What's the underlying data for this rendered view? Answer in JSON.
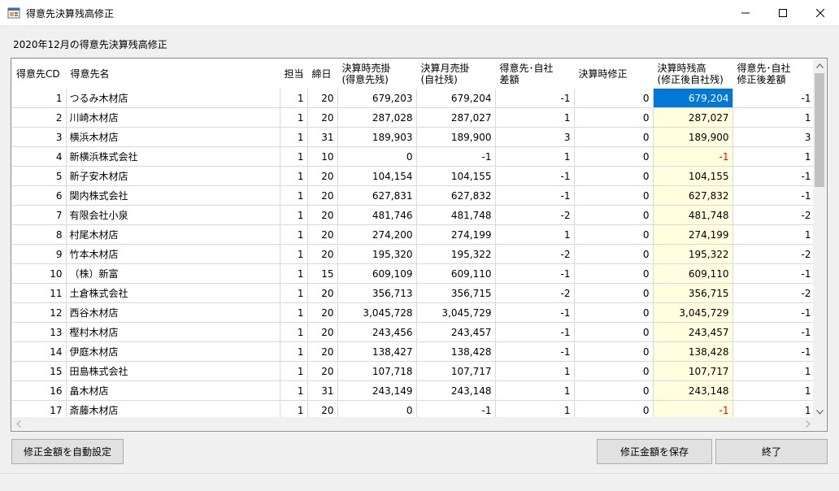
{
  "window": {
    "title": "得意先決算残高修正"
  },
  "subtitle": "2020年12月の得意先決算残高修正",
  "columns": [
    {
      "key": "cd",
      "l1": "得意先CD",
      "l2": ""
    },
    {
      "key": "name",
      "l1": "得意先名",
      "l2": ""
    },
    {
      "key": "staff",
      "l1": "担当",
      "l2": ""
    },
    {
      "key": "close",
      "l1": "締日",
      "l2": ""
    },
    {
      "key": "ar",
      "l1": "決算時売掛",
      "l2": "(得意先残)"
    },
    {
      "key": "ar_self",
      "l1": "決算月売掛",
      "l2": "(自社残)"
    },
    {
      "key": "diff",
      "l1": "得意先･自社",
      "l2": "差額"
    },
    {
      "key": "adj",
      "l1": "決算時修正",
      "l2": ""
    },
    {
      "key": "bal",
      "l1": "決算時残高",
      "l2": "(修正後自社残)"
    },
    {
      "key": "diff2",
      "l1": "得意先･自社",
      "l2": "修正後差額"
    }
  ],
  "rows": [
    {
      "cd": "1",
      "name": "つるみ木材店",
      "staff": "1",
      "close": "20",
      "ar": "679,203",
      "ar_self": "679,204",
      "diff": "-1",
      "adj": "0",
      "bal": "679,204",
      "diff2": "-1"
    },
    {
      "cd": "2",
      "name": "川崎木材店",
      "staff": "1",
      "close": "20",
      "ar": "287,028",
      "ar_self": "287,027",
      "diff": "1",
      "adj": "0",
      "bal": "287,027",
      "diff2": "1"
    },
    {
      "cd": "3",
      "name": "横浜木材店",
      "staff": "1",
      "close": "31",
      "ar": "189,903",
      "ar_self": "189,900",
      "diff": "3",
      "adj": "0",
      "bal": "189,900",
      "diff2": "3"
    },
    {
      "cd": "4",
      "name": "新横浜株式会社",
      "staff": "1",
      "close": "10",
      "ar": "0",
      "ar_self": "-1",
      "diff": "1",
      "adj": "0",
      "bal": "-1",
      "diff2": "1"
    },
    {
      "cd": "5",
      "name": "新子安木材店",
      "staff": "1",
      "close": "20",
      "ar": "104,154",
      "ar_self": "104,155",
      "diff": "-1",
      "adj": "0",
      "bal": "104,155",
      "diff2": "-1"
    },
    {
      "cd": "6",
      "name": "関内株式会社",
      "staff": "1",
      "close": "20",
      "ar": "627,831",
      "ar_self": "627,832",
      "diff": "-1",
      "adj": "0",
      "bal": "627,832",
      "diff2": "-1"
    },
    {
      "cd": "7",
      "name": "有限会社小泉",
      "staff": "1",
      "close": "20",
      "ar": "481,746",
      "ar_self": "481,748",
      "diff": "-2",
      "adj": "0",
      "bal": "481,748",
      "diff2": "-2"
    },
    {
      "cd": "8",
      "name": "村尾木材店",
      "staff": "1",
      "close": "20",
      "ar": "274,200",
      "ar_self": "274,199",
      "diff": "1",
      "adj": "0",
      "bal": "274,199",
      "diff2": "1"
    },
    {
      "cd": "9",
      "name": "竹本木材店",
      "staff": "1",
      "close": "20",
      "ar": "195,320",
      "ar_self": "195,322",
      "diff": "-2",
      "adj": "0",
      "bal": "195,322",
      "diff2": "-2"
    },
    {
      "cd": "10",
      "name": "（株）新富",
      "staff": "1",
      "close": "15",
      "ar": "609,109",
      "ar_self": "609,110",
      "diff": "-1",
      "adj": "0",
      "bal": "609,110",
      "diff2": "-1"
    },
    {
      "cd": "11",
      "name": "土倉株式会社",
      "staff": "1",
      "close": "20",
      "ar": "356,713",
      "ar_self": "356,715",
      "diff": "-2",
      "adj": "0",
      "bal": "356,715",
      "diff2": "-2"
    },
    {
      "cd": "12",
      "name": "西谷木材店",
      "staff": "1",
      "close": "20",
      "ar": "3,045,728",
      "ar_self": "3,045,729",
      "diff": "-1",
      "adj": "0",
      "bal": "3,045,729",
      "diff2": "-1"
    },
    {
      "cd": "13",
      "name": "樫村木材店",
      "staff": "1",
      "close": "20",
      "ar": "243,456",
      "ar_self": "243,457",
      "diff": "-1",
      "adj": "0",
      "bal": "243,457",
      "diff2": "-1"
    },
    {
      "cd": "14",
      "name": "伊庭木材店",
      "staff": "1",
      "close": "20",
      "ar": "138,427",
      "ar_self": "138,428",
      "diff": "-1",
      "adj": "0",
      "bal": "138,428",
      "diff2": "-1"
    },
    {
      "cd": "15",
      "name": "田島株式会社",
      "staff": "1",
      "close": "20",
      "ar": "107,718",
      "ar_self": "107,717",
      "diff": "1",
      "adj": "0",
      "bal": "107,717",
      "diff2": "1"
    },
    {
      "cd": "16",
      "name": "畠木材店",
      "staff": "1",
      "close": "31",
      "ar": "243,149",
      "ar_self": "243,148",
      "diff": "1",
      "adj": "0",
      "bal": "243,148",
      "diff2": "1"
    },
    {
      "cd": "17",
      "name": "斎藤木材店",
      "staff": "1",
      "close": "20",
      "ar": "0",
      "ar_self": "-1",
      "diff": "1",
      "adj": "0",
      "bal": "-1",
      "diff2": "1"
    }
  ],
  "selected_row": 0,
  "selected_column": "bal",
  "buttons": {
    "auto": "修正金額を自動設定",
    "save": "修正金額を保存",
    "end": "終了"
  },
  "colors": {
    "selection": "#0078d7",
    "editable_bg": "#ffffe0",
    "negative": "#ff0000"
  }
}
